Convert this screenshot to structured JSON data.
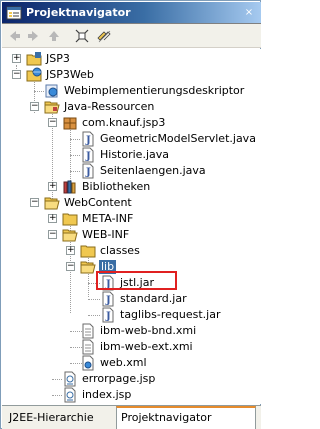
{
  "window": {
    "title": "Projektnavigator",
    "close_glyph": "×",
    "title_icon": "navigator-icon"
  },
  "toolbar": {
    "buttons": [
      {
        "name": "back-icon"
      },
      {
        "name": "forward-icon"
      },
      {
        "name": "up-icon"
      },
      {
        "name": "collapse-all-icon"
      },
      {
        "name": "link-with-editor-icon"
      }
    ]
  },
  "tree": {
    "items": [
      {
        "label": "JSP3",
        "icon": "project-icon",
        "twisty": "+"
      },
      {
        "label": "JSP3Web",
        "icon": "web-project-icon",
        "twisty": "−"
      },
      {
        "label": "Webimplementierungsdeskriptor",
        "icon": "deployment-descriptor-icon",
        "twisty": ""
      },
      {
        "label": "Java-Ressourcen",
        "icon": "folder-open-icon",
        "twisty": "−"
      },
      {
        "label": "com.knauf.jsp3",
        "icon": "package-icon",
        "twisty": "−"
      },
      {
        "label": "GeometricModelServlet.java",
        "icon": "java-file-icon",
        "twisty": ""
      },
      {
        "label": "Historie.java",
        "icon": "java-file-icon",
        "twisty": ""
      },
      {
        "label": "Seitenlaengen.java",
        "icon": "java-file-icon",
        "twisty": ""
      },
      {
        "label": "Bibliotheken",
        "icon": "library-icon",
        "twisty": "+"
      },
      {
        "label": "WebContent",
        "icon": "folder-open-icon",
        "twisty": "−"
      },
      {
        "label": "META-INF",
        "icon": "folder-icon",
        "twisty": "+"
      },
      {
        "label": "WEB-INF",
        "icon": "folder-open-icon",
        "twisty": "−"
      },
      {
        "label": "classes",
        "icon": "folder-icon",
        "twisty": "+"
      },
      {
        "label": "lib",
        "icon": "folder-open-icon",
        "twisty": "−",
        "selected": true
      },
      {
        "label": "jstl.jar",
        "icon": "jar-file-icon",
        "twisty": ""
      },
      {
        "label": "standard.jar",
        "icon": "jar-file-icon",
        "twisty": ""
      },
      {
        "label": "taglibs-request.jar",
        "icon": "jar-file-icon",
        "twisty": ""
      },
      {
        "label": "ibm-web-bnd.xmi",
        "icon": "xmi-file-icon",
        "twisty": ""
      },
      {
        "label": "ibm-web-ext.xmi",
        "icon": "xmi-file-icon",
        "twisty": ""
      },
      {
        "label": "web.xml",
        "icon": "xml-file-icon",
        "twisty": ""
      },
      {
        "label": "errorpage.jsp",
        "icon": "jsp-file-icon",
        "twisty": ""
      },
      {
        "label": "index.jsp",
        "icon": "jsp-file-icon",
        "twisty": ""
      }
    ]
  },
  "tabs": [
    {
      "label": "J2EE-Hierarchie",
      "active": false
    },
    {
      "label": "Projektnavigator",
      "active": true
    }
  ],
  "colors": {
    "highlight_border": "#e02020",
    "title_gradient_start": "#0a246a",
    "selection_bg": "#c1d2ee",
    "folder_yellow": "#f0c850",
    "active_tab_accent": "#e68b2c"
  }
}
